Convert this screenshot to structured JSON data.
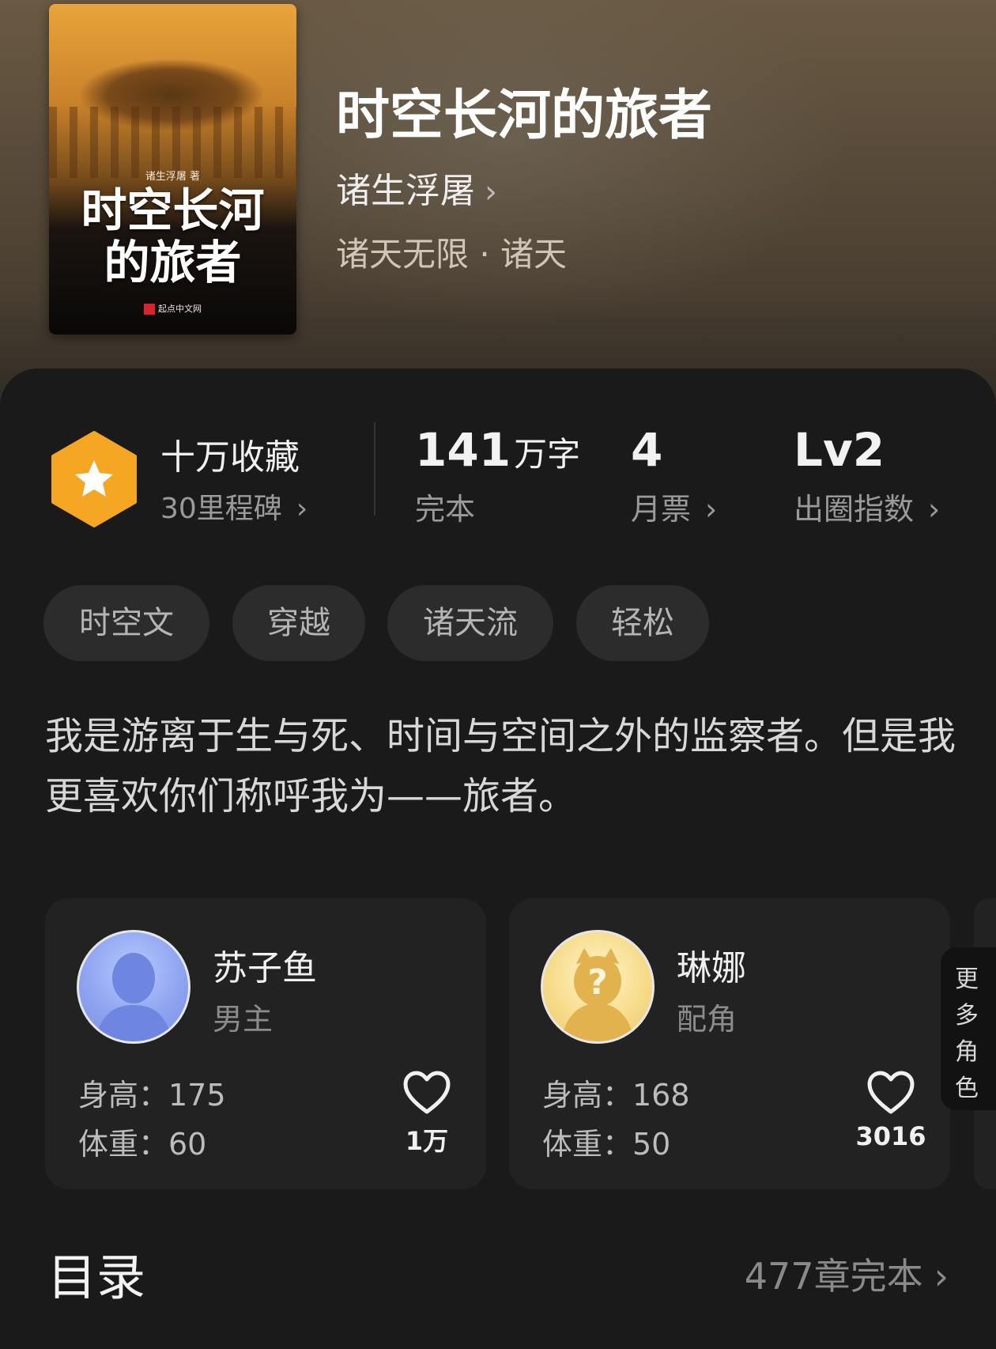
{
  "book": {
    "cover": {
      "title": "时空长河\n的旅者",
      "author_line": "诸生浮屠 著",
      "publisher": "起点中文网"
    },
    "title": "时空长河的旅者",
    "author": "诸生浮屠",
    "genre": "诸天无限 · 诸天"
  },
  "stats": {
    "milestone_label": "十万收藏",
    "milestone_sub": "30里程碑",
    "words_value": "141",
    "words_unit": "万字",
    "words_label": "完本",
    "tickets_value": "4",
    "tickets_label": "月票",
    "index_value": "Lv2",
    "index_label": "出圈指数"
  },
  "tags": [
    "时空文",
    "穿越",
    "诸天流",
    "轻松"
  ],
  "description": "我是游离于生与死、时间与空间之外的监察者。但是我更喜欢你们称呼我为——旅者。",
  "roles": [
    {
      "name": "苏子鱼",
      "type": "男主",
      "height": "身高：175",
      "weight": "体重：60",
      "likes": "1万"
    },
    {
      "name": "琳娜",
      "type": "配角",
      "height": "身高：168",
      "weight": "体重：50",
      "likes": "3016"
    }
  ],
  "more_roles": "更多角色",
  "toc": {
    "title": "目录",
    "status": "477章完本"
  },
  "colors": {
    "background": "#1a1a1a",
    "badge": "#f5a623",
    "card": "#222222",
    "tag_bg": "#2c2c2c"
  },
  "icons": {
    "badge": "star-hexagon-icon",
    "like": "heart-icon",
    "chevron": "chevron-right-icon"
  }
}
